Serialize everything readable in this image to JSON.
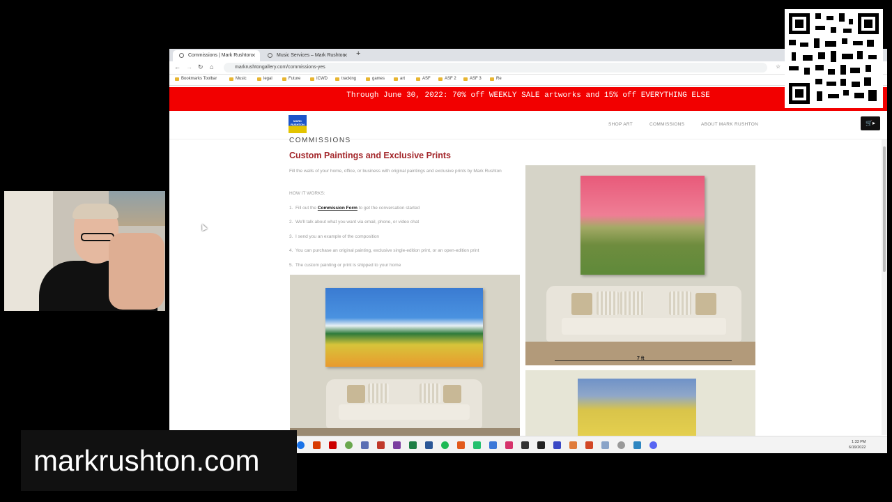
{
  "browser": {
    "tabs": [
      {
        "label": "Commissions | Mark Rushton",
        "active": true
      },
      {
        "label": "Music Services – Mark Rushton",
        "active": false
      }
    ],
    "new_tab": "+",
    "nav": {
      "back": "←",
      "forward": "→",
      "reload": "↻",
      "home": "⌂"
    },
    "url": "markrushtongallery.com/commissions-yes",
    "bookmarks": [
      "Bookmarks Toolbar",
      "Music",
      "legal",
      "Future",
      "ICWD",
      "tracking",
      "games",
      "art",
      "ASF",
      "ASF 2",
      "ASF 3",
      "Re"
    ]
  },
  "site": {
    "banner": "Through June 30, 2022:  70% off WEEKLY SALE artworks and 15% off EVERYTHING ELSE",
    "logo_text": "MARK RUSHTON",
    "menu": [
      "SHOP ART",
      "COMMISSIONS",
      "ABOUT MARK RUSHTON"
    ],
    "cart_label": "🛒▸"
  },
  "content": {
    "section_title": "COMMISSIONS",
    "heading": "Custom Paintings and Exclusive Prints",
    "intro": "Fill the walls of your home, office, or business with original paintings and exclusive prints by Mark Rushton",
    "how_label": "HOW IT WORKS:",
    "steps": [
      {
        "num": "1.",
        "pre": "Fill out the",
        "link": "Commission Form",
        "post": "to get the conversation started"
      },
      {
        "num": "2.",
        "text": "We'll talk about what you want via email, phone, or video chat"
      },
      {
        "num": "3.",
        "text": "I send you an example of the composition"
      },
      {
        "num": "4.",
        "text": "You can purchase an original painting, exclusive single-edition print, or an open-edition print"
      },
      {
        "num": "5.",
        "text": "The custom painting or print is shipped to your home"
      }
    ],
    "dimension_label": "7 ft"
  },
  "taskbar": {
    "time": "1:33 PM",
    "date": "6/19/2022"
  },
  "overlay": {
    "site_url": "markrushton.com"
  },
  "colors": {
    "banner": "#f20000",
    "heading": "#a3262a",
    "logo_blue": "#1d55c9",
    "logo_yellow": "#e3c400"
  }
}
